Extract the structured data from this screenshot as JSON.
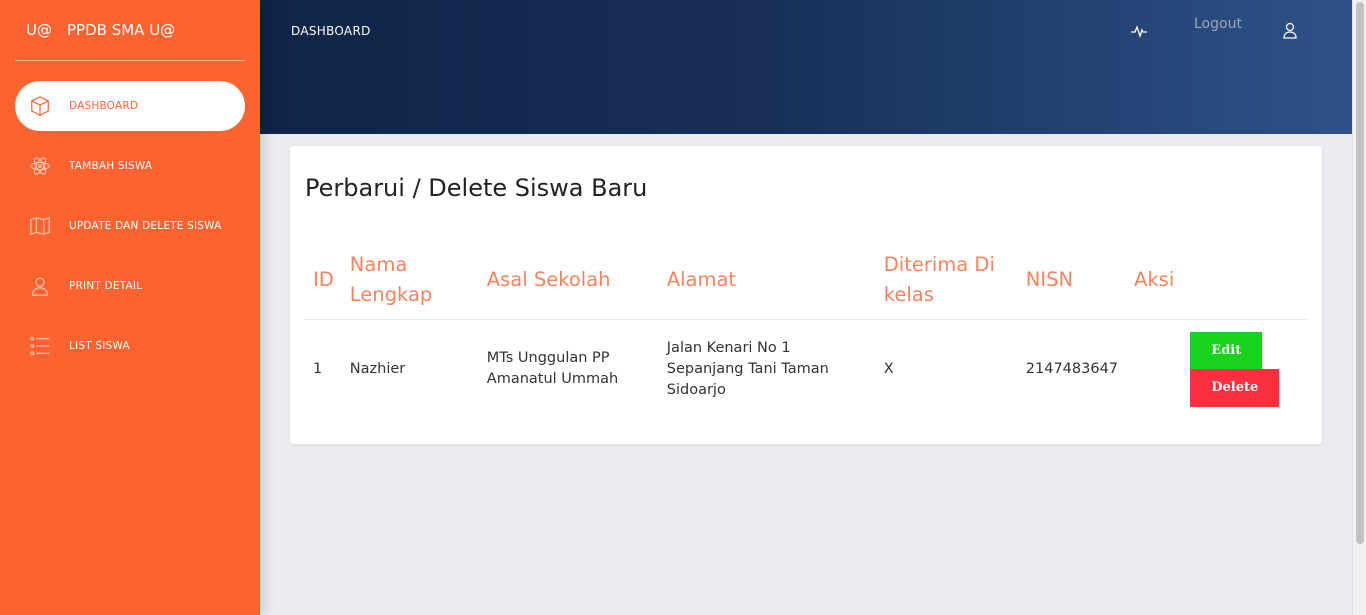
{
  "sidebar": {
    "brand_mini": "U@",
    "brand_full": "PPDB SMA U@",
    "items": [
      {
        "label": "DASHBOARD",
        "icon": "cube-icon"
      },
      {
        "label": "TAMBAH SISWA",
        "icon": "atom-icon"
      },
      {
        "label": "UPDATE DAN DELETE SISWA",
        "icon": "map-icon"
      },
      {
        "label": "PRINT DETAIL",
        "icon": "user-icon"
      },
      {
        "label": "LIST SISWA",
        "icon": "list-icon"
      }
    ]
  },
  "topbar": {
    "title": "DASHBOARD",
    "logout": "Logout",
    "icons": [
      "pulse-icon",
      "user-icon"
    ]
  },
  "card": {
    "title": "Perbarui / Delete Siswa Baru"
  },
  "table": {
    "headers": [
      "ID",
      "Nama Lengkap",
      "Asal Sekolah",
      "Alamat",
      "Diterima Di kelas",
      "NISN",
      "Aksi"
    ],
    "rows": [
      {
        "id": "1",
        "nama": "Nazhier",
        "asal": "MTs Unggulan PP Amanatul Ummah",
        "alamat": "Jalan Kenari No 1 Sepanjang Tani Taman Sidoarjo",
        "kelas": "X",
        "nisn": "2147483647",
        "edit_label": "Edit",
        "delete_label": "Delete"
      }
    ]
  },
  "colors": {
    "sidebar": "#fd6331",
    "header_text": "#f4845f",
    "edit": "#18d21b",
    "delete": "#fb3141"
  }
}
